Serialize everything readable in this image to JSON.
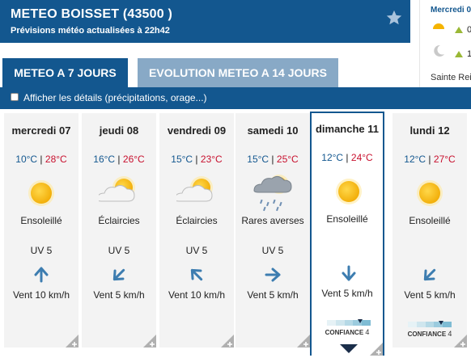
{
  "header": {
    "title": "METEO BOISSET (43500 )",
    "subtitle": "Prévisions météo actualisées à 22h42",
    "favorite_icon": "star-icon"
  },
  "side_panel": {
    "day": "Mercredi 0",
    "rows": [
      {
        "icon": "sun-icon",
        "trend": "up",
        "value": "0"
      },
      {
        "icon": "moon-icon",
        "trend": "up",
        "value": "1"
      }
    ],
    "location": "Sainte Rei"
  },
  "tabs": [
    {
      "label": "METEO A 7 JOURS",
      "active": true
    },
    {
      "label": "EVOLUTION METEO A 14 JOURS",
      "active": false
    }
  ],
  "details_checkbox": {
    "label": "Afficher les détails (précipitations, orage...)",
    "checked": false
  },
  "days": [
    {
      "name": "mercredi 07",
      "tmin": "10°C",
      "tmax": "28°C",
      "icon": "sunny",
      "desc": "Ensoleillé",
      "uv": "UV 5",
      "wind_dir": "up",
      "wind": "Vent 10 km/h",
      "selected": false
    },
    {
      "name": "jeudi 08",
      "tmin": "16°C",
      "tmax": "26°C",
      "icon": "partly-cloudy",
      "desc": "Éclaircies",
      "uv": "UV 5",
      "wind_dir": "down-left",
      "wind": "Vent 5 km/h",
      "selected": false
    },
    {
      "name": "vendredi 09",
      "tmin": "15°C",
      "tmax": "23°C",
      "icon": "partly-cloudy",
      "desc": "Éclaircies",
      "uv": "UV 5",
      "wind_dir": "up-left",
      "wind": "Vent 10 km/h",
      "selected": false
    },
    {
      "name": "samedi 10",
      "tmin": "15°C",
      "tmax": "25°C",
      "icon": "showers",
      "desc": "Rares averses",
      "uv": "UV 5",
      "wind_dir": "right",
      "wind": "Vent 5 km/h",
      "selected": false
    },
    {
      "name": "dimanche 11",
      "tmin": "12°C",
      "tmax": "24°C",
      "icon": "sunny",
      "desc": "Ensoleillé",
      "uv": "",
      "wind_dir": "down",
      "wind": "Vent 5 km/h",
      "selected": true,
      "confidence_label": "CONFIANCE",
      "confidence": "4"
    },
    {
      "name": "lundi 12",
      "tmin": "12°C",
      "tmax": "27°C",
      "icon": "sunny",
      "desc": "Ensoleillé",
      "uv": "",
      "wind_dir": "down-left",
      "wind": "Vent 5 km/h",
      "selected": false,
      "confidence_label": "CONFIANCE",
      "confidence": "4"
    }
  ],
  "colors": {
    "brand": "#13578f",
    "tab_inactive": "#88a9c6",
    "min_temp": "#13578f",
    "max_temp": "#c8102e",
    "sun": "#f5b400",
    "wind_arrow": "#3d7db0"
  }
}
